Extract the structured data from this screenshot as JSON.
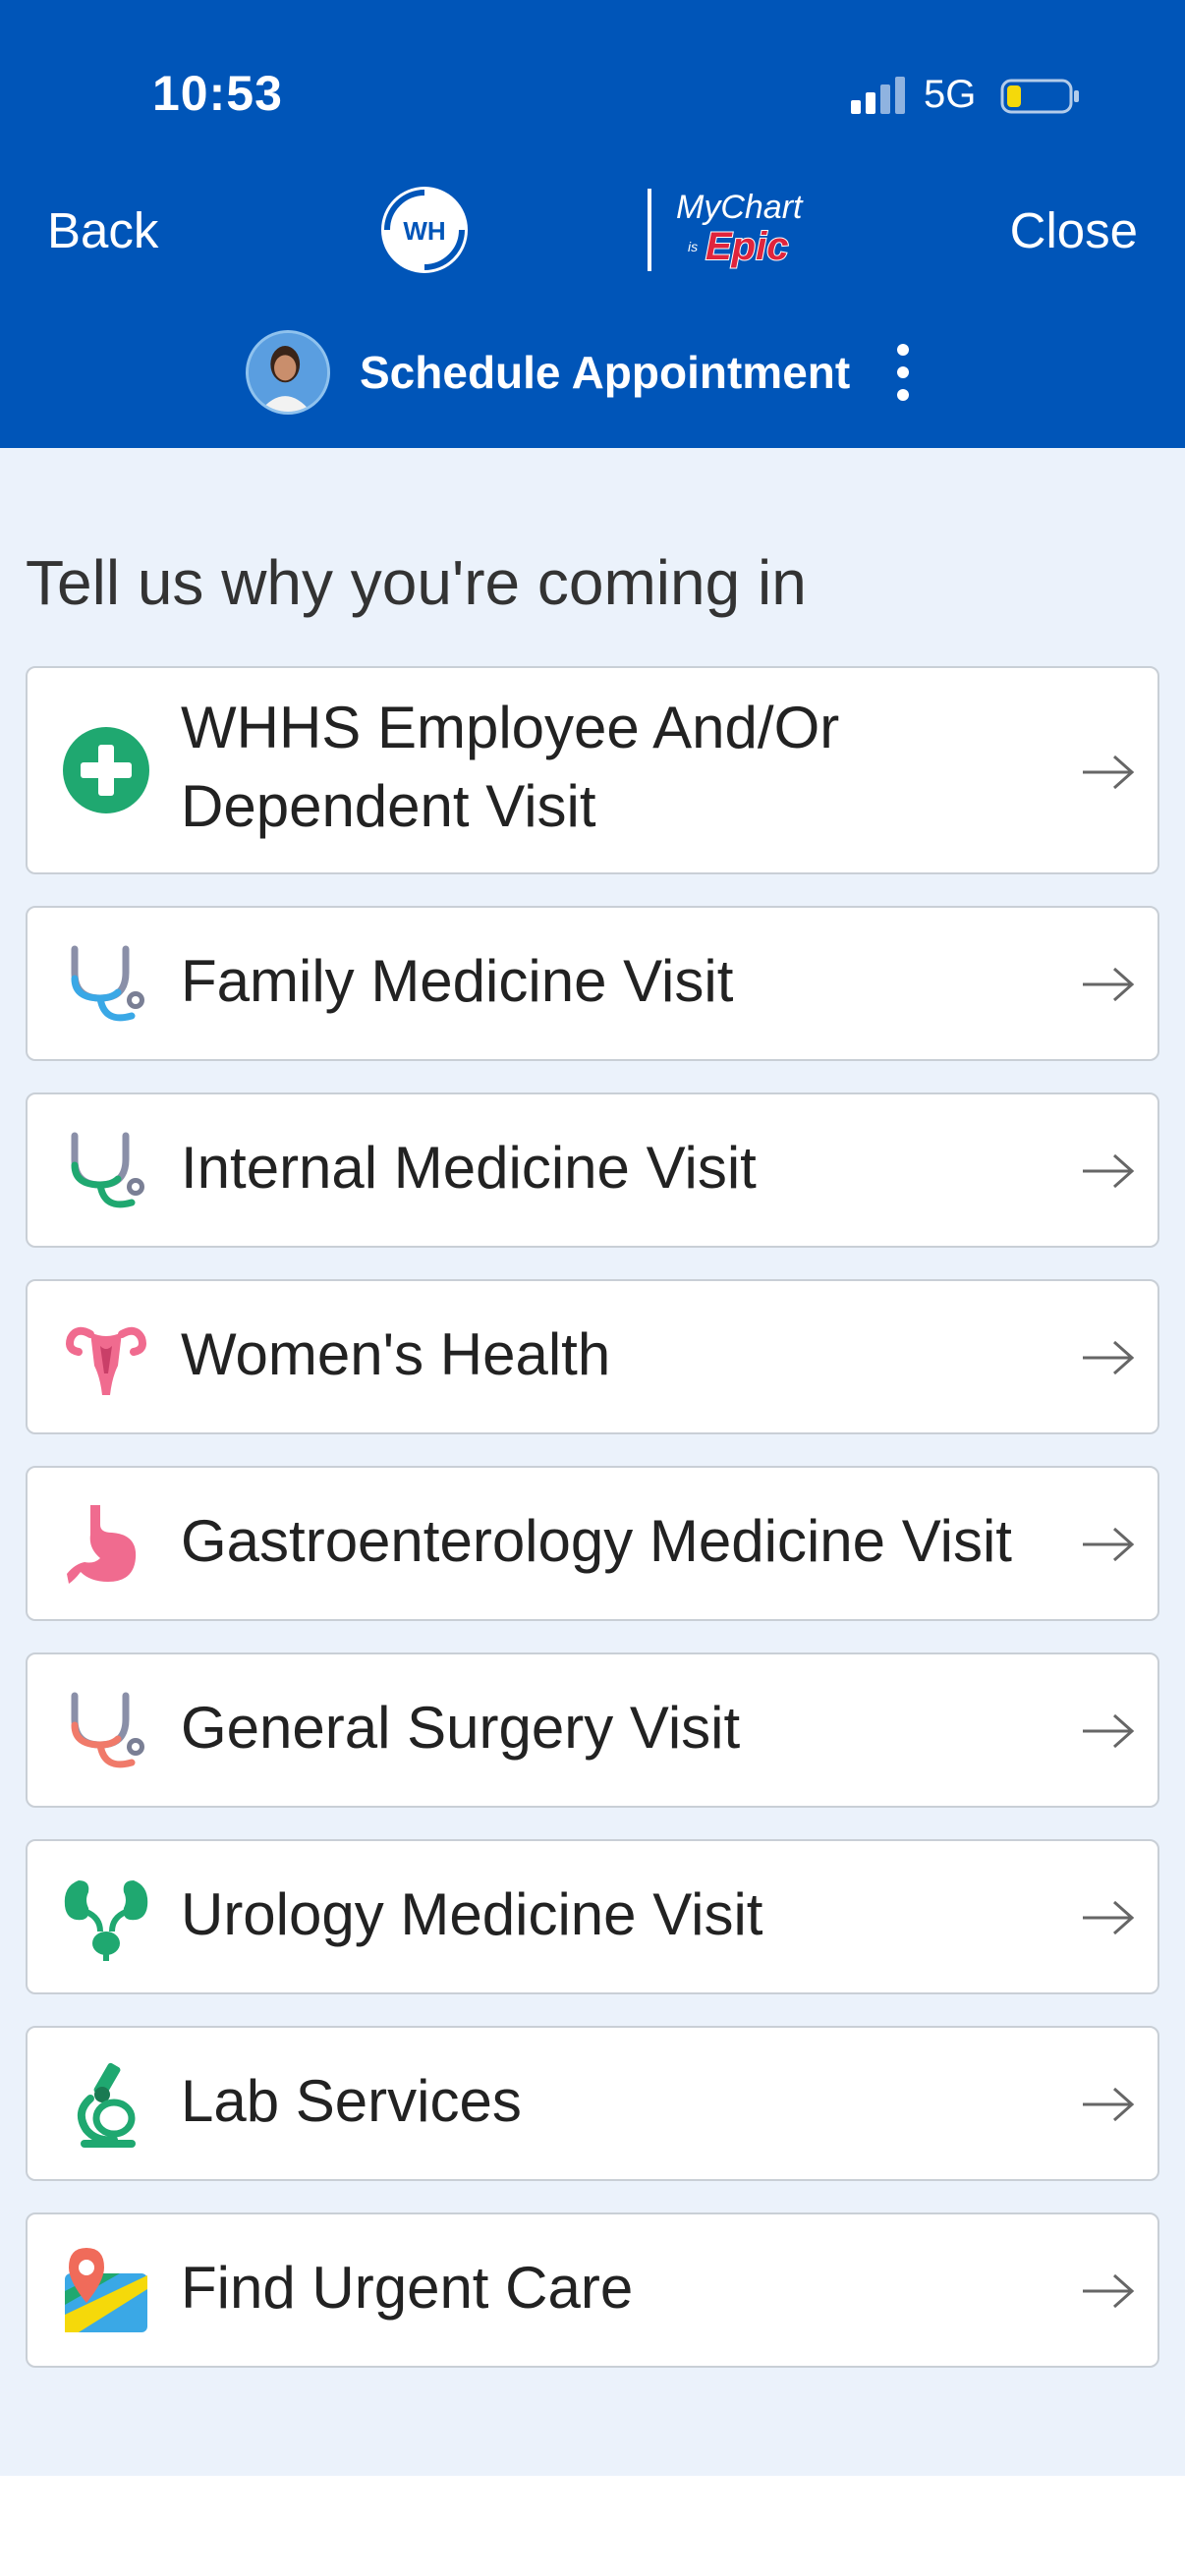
{
  "status_bar": {
    "time": "10:53",
    "network": "5G"
  },
  "nav": {
    "back_label": "Back",
    "close_label": "Close"
  },
  "header": {
    "title": "Schedule Appointment"
  },
  "main": {
    "heading": "Tell us why you're coming in",
    "options": [
      {
        "label": "WHHS Employee And/Or",
        "label2": "Dependent Visit",
        "icon": "green-cross-icon"
      },
      {
        "label": "Family Medicine Visit",
        "icon": "stethoscope-icon"
      },
      {
        "label": "Internal Medicine Visit",
        "icon": "stethoscope-icon"
      },
      {
        "label": "Women's Health",
        "icon": "uterus-icon"
      },
      {
        "label": "Gastroenterology Medicine Visit",
        "icon": "stomach-icon"
      },
      {
        "label": "General Surgery Visit",
        "icon": "stethoscope-icon"
      },
      {
        "label": "Urology Medicine Visit",
        "icon": "kidneys-icon"
      },
      {
        "label": "Lab Services",
        "icon": "microscope-icon"
      },
      {
        "label": "Find Urgent Care",
        "icon": "map-pin-icon"
      }
    ]
  },
  "colors": {
    "header_bg": "#0055b8",
    "content_bg": "#ebf2fb",
    "accent_green": "#1fa870",
    "accent_pink": "#f06b8f"
  }
}
